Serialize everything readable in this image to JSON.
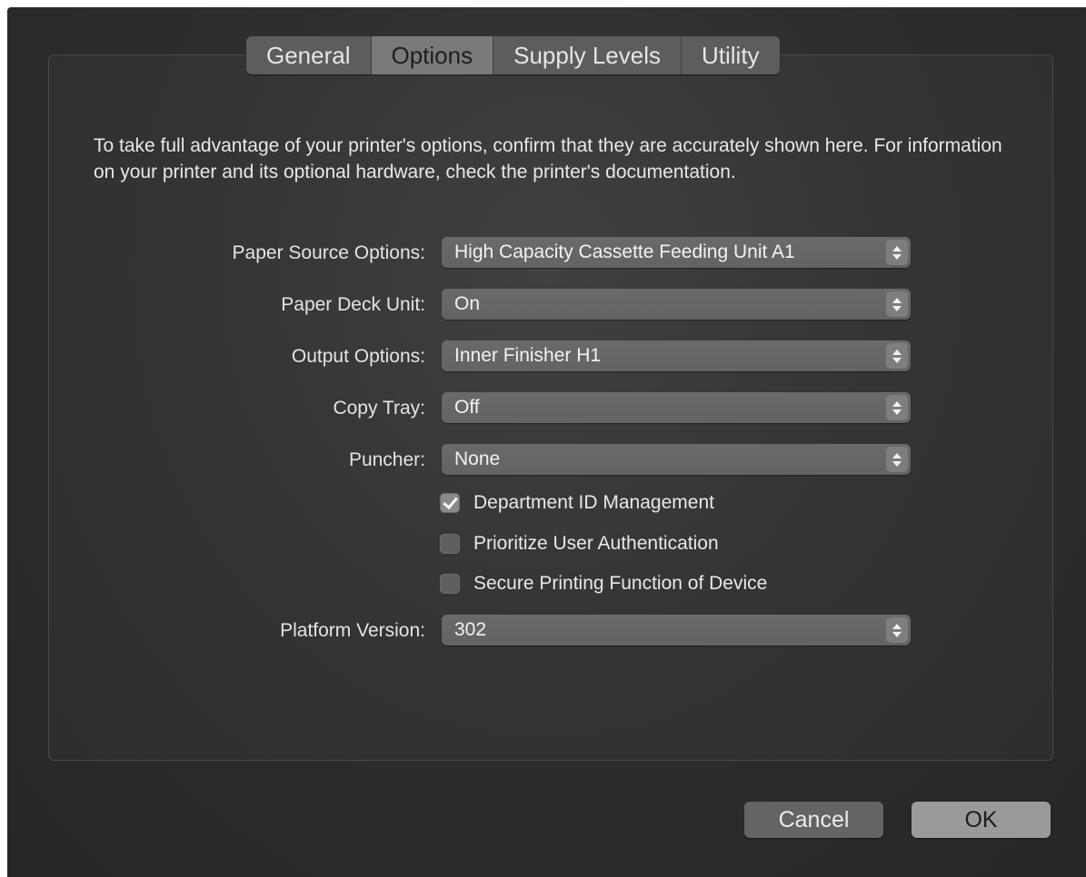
{
  "tabs": [
    {
      "label": "General",
      "selected": false
    },
    {
      "label": "Options",
      "selected": true
    },
    {
      "label": "Supply Levels",
      "selected": false
    },
    {
      "label": "Utility",
      "selected": false
    }
  ],
  "intro_text": "To take full advantage of your printer's options, confirm that they are accurately shown here. For information on your printer and its optional hardware, check the printer's documentation.",
  "fields": {
    "paper_source": {
      "label": "Paper Source Options:",
      "value": "High Capacity Cassette Feeding Unit A1"
    },
    "paper_deck": {
      "label": "Paper Deck Unit:",
      "value": "On"
    },
    "output_options": {
      "label": "Output Options:",
      "value": "Inner Finisher H1"
    },
    "copy_tray": {
      "label": "Copy Tray:",
      "value": "Off"
    },
    "puncher": {
      "label": "Puncher:",
      "value": "None"
    },
    "platform_version": {
      "label": "Platform Version:",
      "value": "302"
    }
  },
  "checkboxes": {
    "department_id": {
      "label": "Department ID Management",
      "checked": true
    },
    "prioritize_auth": {
      "label": "Prioritize User Authentication",
      "checked": false
    },
    "secure_printing": {
      "label": "Secure Printing Function of Device",
      "checked": false
    }
  },
  "buttons": {
    "cancel": "Cancel",
    "ok": "OK"
  }
}
